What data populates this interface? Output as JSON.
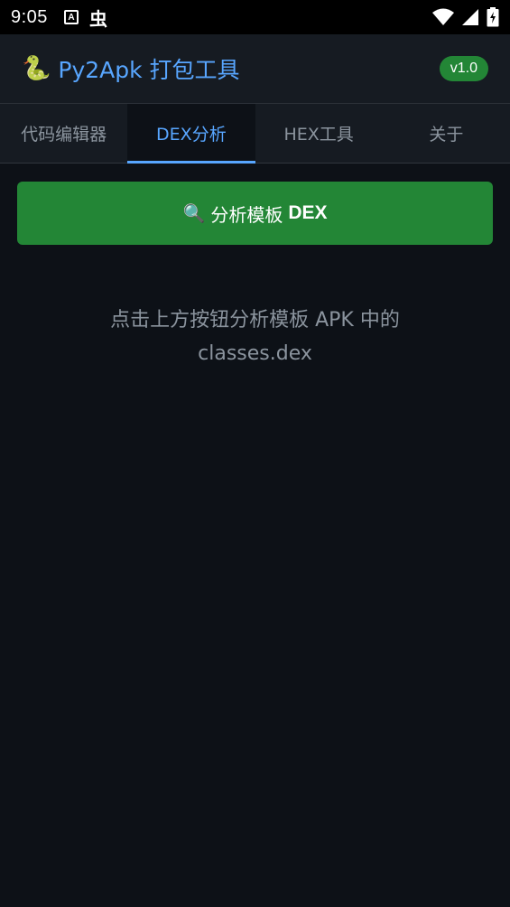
{
  "status_bar": {
    "time": "9:05",
    "notification_icon_a": "A",
    "notification_glyph": "虫",
    "icons": [
      "wifi-icon",
      "signal-icon",
      "battery-charging-icon"
    ]
  },
  "app_bar": {
    "logo_icon": "🐍",
    "title": "Py2Apk 打包工具",
    "version": "v1.0"
  },
  "tabs": [
    {
      "label": "代码编辑器",
      "active": false
    },
    {
      "label": "DEX分析",
      "active": true
    },
    {
      "label": "HEX工具",
      "active": false
    },
    {
      "label": "关于",
      "active": false
    }
  ],
  "main": {
    "analyze_button": {
      "icon": "🔍",
      "label_prefix": "分析模板",
      "label_bold": "DEX"
    },
    "hint_line1": "点击上方按钮分析模板 APK 中的",
    "hint_line2": "classes.dex"
  },
  "colors": {
    "background": "#0d1117",
    "surface": "#161b22",
    "accent": "#58a6ff",
    "button_green": "#238636",
    "muted_text": "#8b949e"
  }
}
